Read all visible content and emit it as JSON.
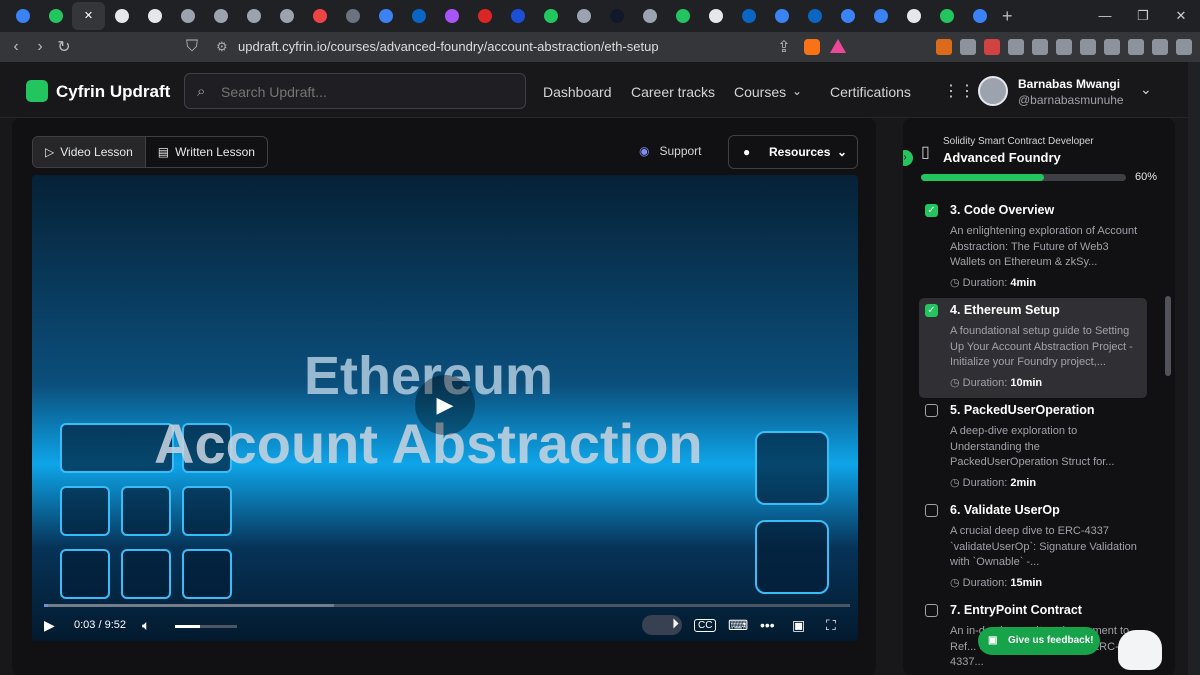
{
  "browser": {
    "tabs": [
      {
        "icon": "cyfrin-icon",
        "color": "#3b82f6"
      },
      {
        "icon": "cyfrin-icon",
        "color": "#22c55e"
      },
      {
        "icon": "close-icon",
        "color": "#ffffff",
        "active": true
      },
      {
        "icon": "github-icon",
        "color": "#e5e7eb"
      },
      {
        "icon": "openai-icon",
        "color": "#e5e7eb"
      },
      {
        "icon": "openai-icon",
        "color": "#9ca3af"
      },
      {
        "icon": "circle-icon",
        "color": "#9ca3af"
      },
      {
        "icon": "circle-icon",
        "color": "#9ca3af"
      },
      {
        "icon": "circle-icon",
        "color": "#9ca3af"
      },
      {
        "icon": "google-icon",
        "color": "#ef4444"
      },
      {
        "icon": "circle-icon",
        "color": "#6b7280"
      },
      {
        "icon": "cyfrin-icon",
        "color": "#3b82f6"
      },
      {
        "icon": "linkedin-icon",
        "color": "#0a66c2"
      },
      {
        "icon": "app-icon",
        "color": "#a855f7"
      },
      {
        "icon": "app-icon",
        "color": "#dc2626"
      },
      {
        "icon": "app-icon",
        "color": "#1d4ed8"
      },
      {
        "icon": "app-icon",
        "color": "#22c55e"
      },
      {
        "icon": "eth-icon",
        "color": "#9ca3af"
      },
      {
        "icon": "app-icon",
        "color": "#111827"
      },
      {
        "icon": "circle-icon",
        "color": "#9ca3af"
      },
      {
        "icon": "cyfrin-icon",
        "color": "#22c55e"
      },
      {
        "icon": "github-icon",
        "color": "#e5e7eb"
      },
      {
        "icon": "linkedin-icon",
        "color": "#0a66c2"
      },
      {
        "icon": "cyfrin-icon",
        "color": "#3b82f6"
      },
      {
        "icon": "linkedin-icon",
        "color": "#0a66c2"
      },
      {
        "icon": "cyfrin-icon",
        "color": "#3b82f6"
      },
      {
        "icon": "cyfrin-icon",
        "color": "#3b82f6"
      },
      {
        "icon": "github-icon",
        "color": "#e5e7eb"
      },
      {
        "icon": "cyfrin-icon",
        "color": "#22c55e"
      },
      {
        "icon": "cyfrin-icon",
        "color": "#3b82f6"
      }
    ],
    "url": "updraft.cyfrin.io/courses/advanced-foundry/account-abstraction/eth-setup",
    "extension_colors": [
      "#f97316",
      "#9ca3af",
      "#ef4444",
      "#9ca3af",
      "#9ca3af",
      "#9ca3af",
      "#9ca3af",
      "#9ca3af",
      "#9ca3af",
      "#9ca3af",
      "#9ca3af"
    ]
  },
  "header": {
    "brand": "Cyfrin Updraft",
    "search_placeholder": "Search Updraft...",
    "nav": [
      "Dashboard",
      "Career tracks",
      "Courses",
      "Certifications"
    ],
    "user_name": "Barnabas Mwangi",
    "user_handle": "@barnabasmunuhe"
  },
  "lesson": {
    "video_tab": "Video Lesson",
    "written_tab": "Written Lesson",
    "support": "Support",
    "resources": "Resources",
    "video_title_line1": "Ethereum",
    "video_title_line2": "Account Abstraction",
    "time": "0:03 / 9:52",
    "progress": 0.005,
    "volume": 0.4,
    "cc": "CC"
  },
  "sidebar": {
    "category": "Solidity Smart Contract Developer",
    "course": "Advanced Foundry",
    "progress_pct": 60,
    "progress_label": "60%",
    "items": [
      {
        "title": "3. Code Overview",
        "desc": "An enlightening exploration of Account Abstraction: The Future of Web3 Wallets on Ethereum & zkSy...",
        "duration_label": "Duration:",
        "duration": "4min",
        "done": true,
        "current": false
      },
      {
        "title": "4. Ethereum Setup",
        "desc": "A foundational setup guide to Setting Up Your Account Abstraction Project - Initialize your Foundry project,...",
        "duration_label": "Duration:",
        "duration": "10min",
        "done": true,
        "current": true
      },
      {
        "title": "5. PackedUserOperation",
        "desc": "A deep-dive exploration to Understanding the PackedUserOperation Struct for...",
        "duration_label": "Duration:",
        "duration": "2min",
        "done": false,
        "current": false
      },
      {
        "title": "6. Validate UserOp",
        "desc": "A crucial deep dive to ERC-4337 `validateUserOp`: Signature Validation with `Ownable` -...",
        "duration_label": "Duration:",
        "duration": "15min",
        "done": false,
        "current": false
      },
      {
        "title": "7. EntryPoint Contract",
        "desc": "An in-depth security enhancement to Ref... Security - Solidify your ERC-4337...",
        "duration_label": "",
        "duration": "",
        "done": false,
        "current": false
      }
    ],
    "feedback": "Give us feedback!"
  },
  "colors": {
    "accent": "#22c55e",
    "bg": "#18181b",
    "panel": "#111113"
  }
}
